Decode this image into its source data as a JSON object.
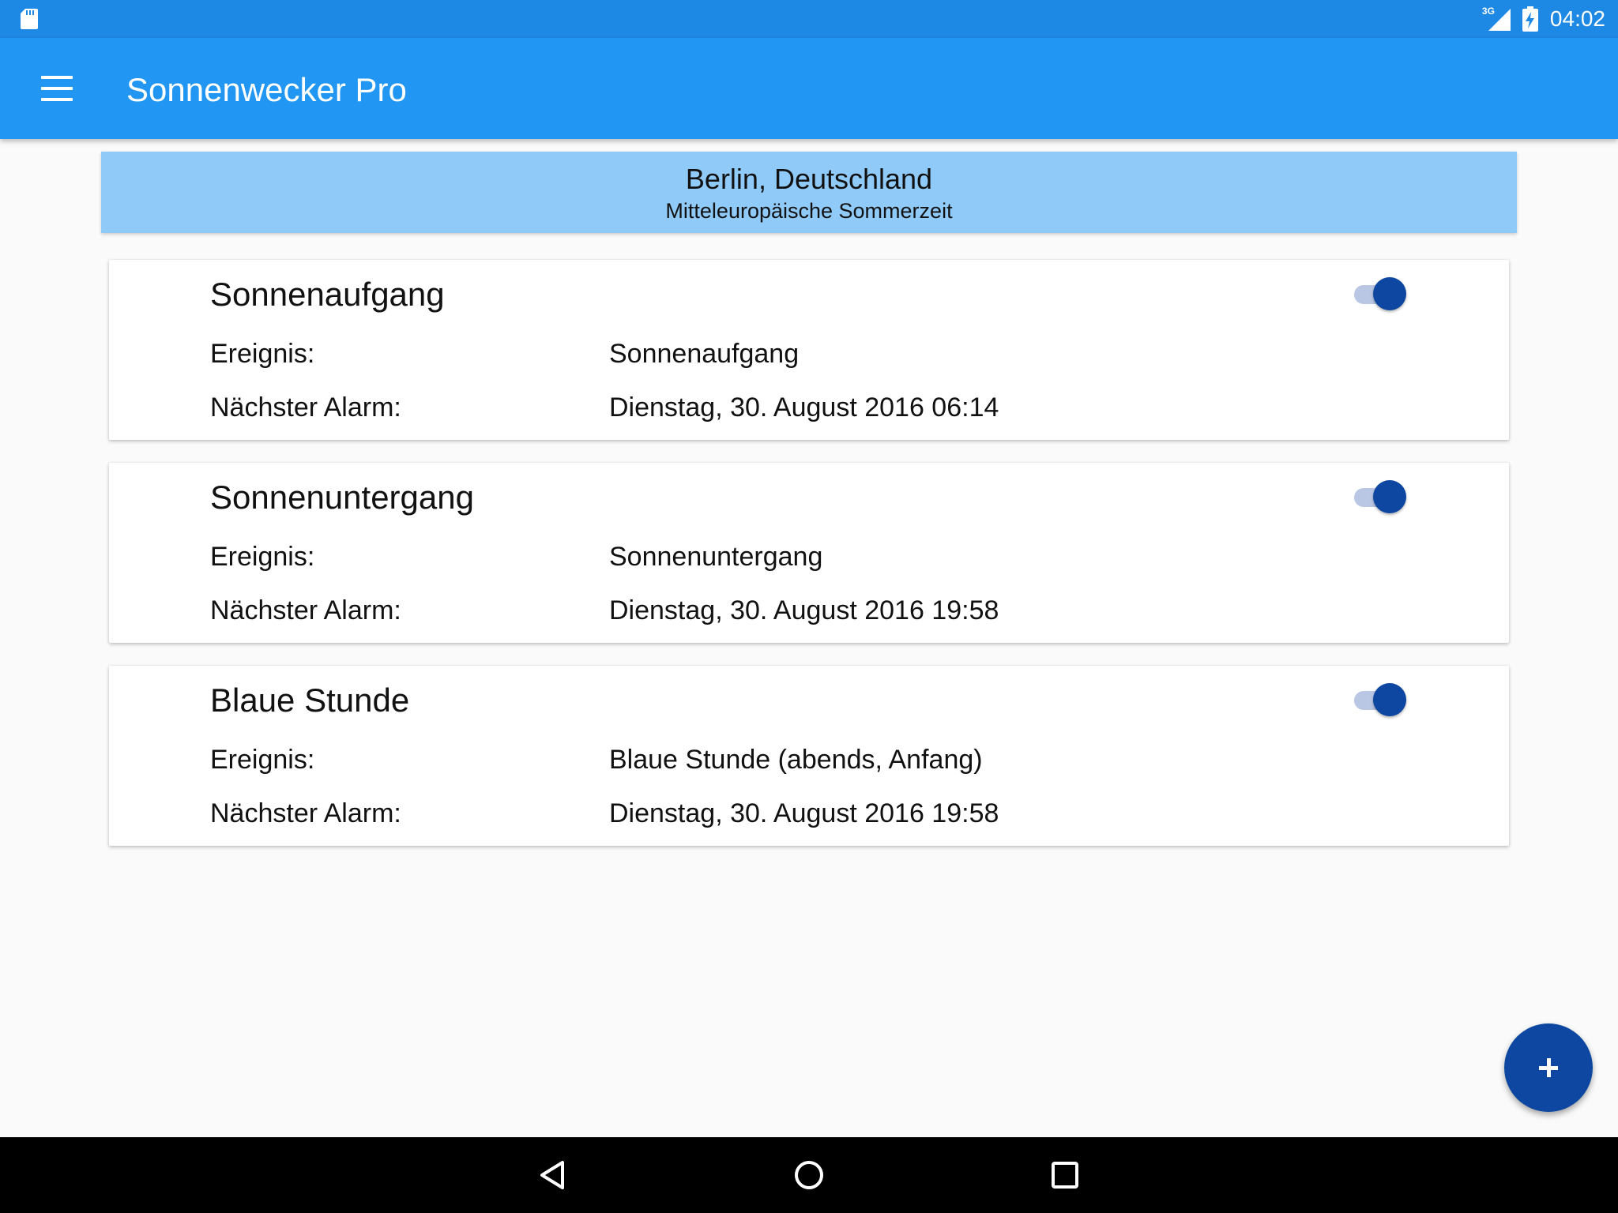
{
  "status_bar": {
    "network_type": "3G",
    "time": "04:02",
    "icons": [
      "sd-card-icon",
      "signal-icon",
      "battery-charging-icon"
    ]
  },
  "app_bar": {
    "title": "Sonnenwecker Pro",
    "menu_icon": "hamburger-menu-icon"
  },
  "location": {
    "city": "Berlin, Deutschland",
    "timezone": "Mitteleuropäische Sommerzeit"
  },
  "alarms": [
    {
      "title": "Sonnenaufgang",
      "event_label": "Ereignis:",
      "event_value": "Sonnenaufgang",
      "next_label": "Nächster Alarm:",
      "next_value": "Dienstag, 30. August 2016 06:14",
      "enabled": true
    },
    {
      "title": "Sonnenuntergang",
      "event_label": "Ereignis:",
      "event_value": "Sonnenuntergang",
      "next_label": "Nächster Alarm:",
      "next_value": "Dienstag, 30. August 2016 19:58",
      "enabled": true
    },
    {
      "title": "Blaue Stunde",
      "event_label": "Ereignis:",
      "event_value": "Blaue Stunde (abends, Anfang)",
      "next_label": "Nächster Alarm:",
      "next_value": "Dienstag, 30. August 2016 19:58",
      "enabled": true
    }
  ],
  "fab": {
    "icon": "plus-icon"
  },
  "nav_bar": {
    "icons": [
      "back-icon",
      "home-icon",
      "recent-apps-icon"
    ]
  },
  "colors": {
    "status_bar": "#1e88e5",
    "app_bar": "#2196f3",
    "location_banner": "#90caf9",
    "accent": "#0d47a1",
    "switch_track": "#b9c6e4",
    "background": "#fafafa"
  }
}
